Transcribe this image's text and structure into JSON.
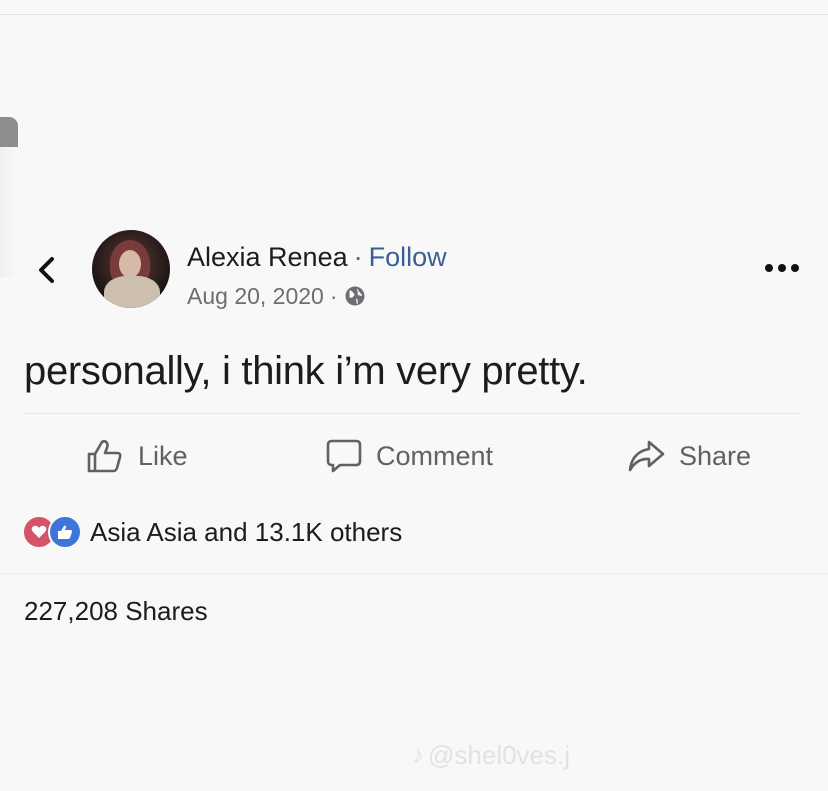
{
  "post": {
    "author_name": "Alexia Renea",
    "separator": "·",
    "follow_label": "Follow",
    "date": "Aug 20, 2020",
    "meta_separator": "·",
    "audience_icon": "globe-icon",
    "text": "personally, i think i’m very pretty."
  },
  "actions": {
    "like_label": "Like",
    "comment_label": "Comment",
    "share_label": "Share"
  },
  "reactions": {
    "icons": [
      "love-reaction-icon",
      "like-reaction-icon"
    ],
    "summary": "Asia Asia and 13.1K others"
  },
  "shares": {
    "label": "227,208 Shares"
  },
  "watermark": {
    "handle": "@shel0ves.j"
  },
  "colors": {
    "follow_link": "#3b5f94",
    "love": "#d4536b",
    "like": "#3d76d8"
  }
}
